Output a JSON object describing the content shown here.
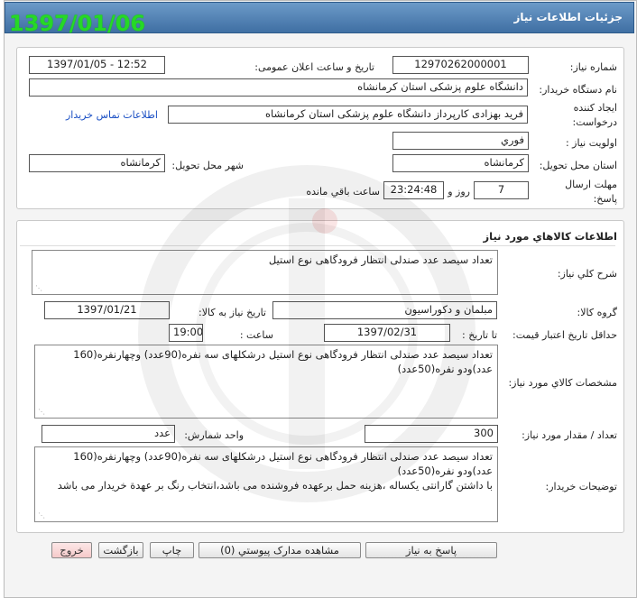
{
  "window": {
    "title": "جزئيات اطلاعات نياز"
  },
  "stamp_date": "1397/01/06",
  "need_info": {
    "need_number_label": "شماره نياز:",
    "need_number": "1297026200000​1",
    "announce_label": "تاريخ و ساعت اعلان عمومی:",
    "announce_value": "1397/01/05 - 12:52",
    "buyer_org_label": "نام دستگاه خريدار:",
    "buyer_org": "دانشگاه علوم پزشکی  استان کرمانشاه",
    "creator_label_1": "ايجاد کننده",
    "creator_label_2": "درخواست:",
    "creator": "فريد  بهزادی کارپرداز دانشگاه علوم پزشکی  استان کرمانشاه",
    "contact_link": "اطلاعات تماس خريدار",
    "priority_label": "اولويت نياز :",
    "priority": "فوري",
    "province_label": "استان محل تحويل:",
    "province": "کرمانشاه",
    "city_label": "شهر محل تحويل:",
    "city": "کرمانشاه",
    "deadline_label_1": "مهلت ارسال",
    "deadline_label_2": "پاسخ:",
    "days": "7",
    "days_word": "روز و",
    "time_remaining": "23:24:48",
    "remaining_word": "ساعت باقي مانده"
  },
  "goods": {
    "section_title": "اطلاعات کالاهاي مورد نياز",
    "summary_label": "شرح کلي نياز:",
    "summary": "تعداد سيصد عدد صندلی انتظار فرودگاهی نوع استيل",
    "group_label": "گروه کالا:",
    "group": "مبلمان و دکوراسيون",
    "need_date_label": "تاريخ نياز به کالا:",
    "need_date": "1397/01/21",
    "min_validity_label": "حداقل تاريخ اعتبار قيمت:",
    "until_date_label": "تا تاريخ :",
    "until_date": "1397/02/31",
    "hour_label": "ساعت :",
    "hour": "19:00",
    "specs_label": "مشخصات کالاي مورد نياز:",
    "specs": "تعداد سيصد عدد صندلی انتظار فرودگاهی نوع استيل درشکلهای سه نفره(90عدد) وچهارنفره(160 عدد)ودو نفره(50عدد)",
    "qty_label": "تعداد / مقدار مورد نياز:",
    "qty": "300",
    "unit_label": "واحد شمارش:",
    "unit": "عدد",
    "buyer_notes_label": "توضيحات خريدار:",
    "buyer_notes_1": "تعداد سيصد عدد صندلی انتظار فرودگاهی نوع استيل درشکلهای سه نفره(90عدد) وچهارنفره(160 عدد)ودو نفره(50عدد)",
    "buyer_notes_2": "با داشتن گارانتی يکساله ،هزينه حمل برعهده فروشنده می باشد،انتخاب رنگ بر عهدة خريدار می باشد"
  },
  "buttons": {
    "reply": "پاسخ به نياز",
    "attachments": "مشاهده مدارک پيوستي (0)",
    "print": "چاپ",
    "back": "بازگشت",
    "exit": "خروج"
  },
  "colors": {
    "title_bar": "#4a78ac",
    "stamp": "#26d826",
    "link": "#1a4fc4"
  }
}
